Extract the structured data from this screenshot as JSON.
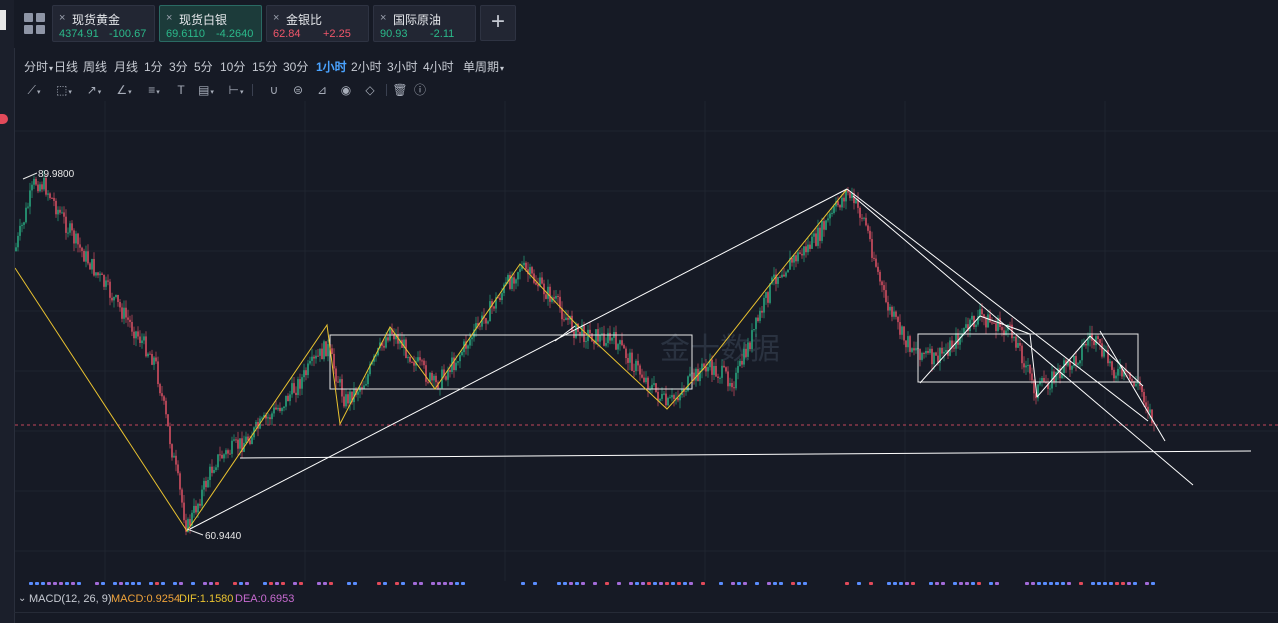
{
  "tabs": [
    {
      "name": "现货黄金",
      "value": "4374.91",
      "change": "-100.67",
      "dir": "down",
      "active": false
    },
    {
      "name": "现货白银",
      "value": "69.6110",
      "change": "-4.2640",
      "dir": "down",
      "active": true
    },
    {
      "name": "金银比",
      "value": "62.84",
      "change": "+2.25",
      "dir": "up",
      "active": false
    },
    {
      "name": "国际原油",
      "value": "90.93",
      "change": "-2.11",
      "dir": "down",
      "active": false
    }
  ],
  "tab_close_glyph": "×",
  "add_tab_glyph": "+",
  "periods": [
    "分时",
    "日线",
    "周线",
    "月线",
    "1分",
    "3分",
    "5分",
    "10分",
    "15分",
    "30分",
    "1小时",
    "2小时",
    "3小时",
    "4小时",
    "单周期"
  ],
  "active_period": "1小时",
  "tools": [
    "line-tool-icon",
    "rectangle-tool-icon",
    "arrow-tool-icon",
    "angle-tool-icon",
    "fib-tool-icon",
    "text-tool-icon",
    "stamp-tool-icon",
    "measure-tool-icon",
    "magnet-icon",
    "sync-icon",
    "ruler-icon",
    "eye-icon",
    "eraser-icon",
    "trash-icon",
    "info-icon"
  ],
  "chart_data": {
    "type": "candlestick",
    "high_label": "89.9800",
    "low_label": "60.9440",
    "watermark": "金十数据",
    "colors": {
      "up": "#2bb98a",
      "down": "#f0566a",
      "wave_line": "#e9c230",
      "trend_line": "#ffffff",
      "background": "#161a25"
    }
  },
  "macd": {
    "name": "MACD(12, 26, 9)",
    "macd_label": "MACD:0.9254",
    "dif_label": "DIF:1.1580",
    "dea_label": "DEA:0.6953",
    "colors": {
      "macd": "#f0a33a",
      "dif": "#e9c230",
      "dea": "#c86bd1"
    }
  }
}
